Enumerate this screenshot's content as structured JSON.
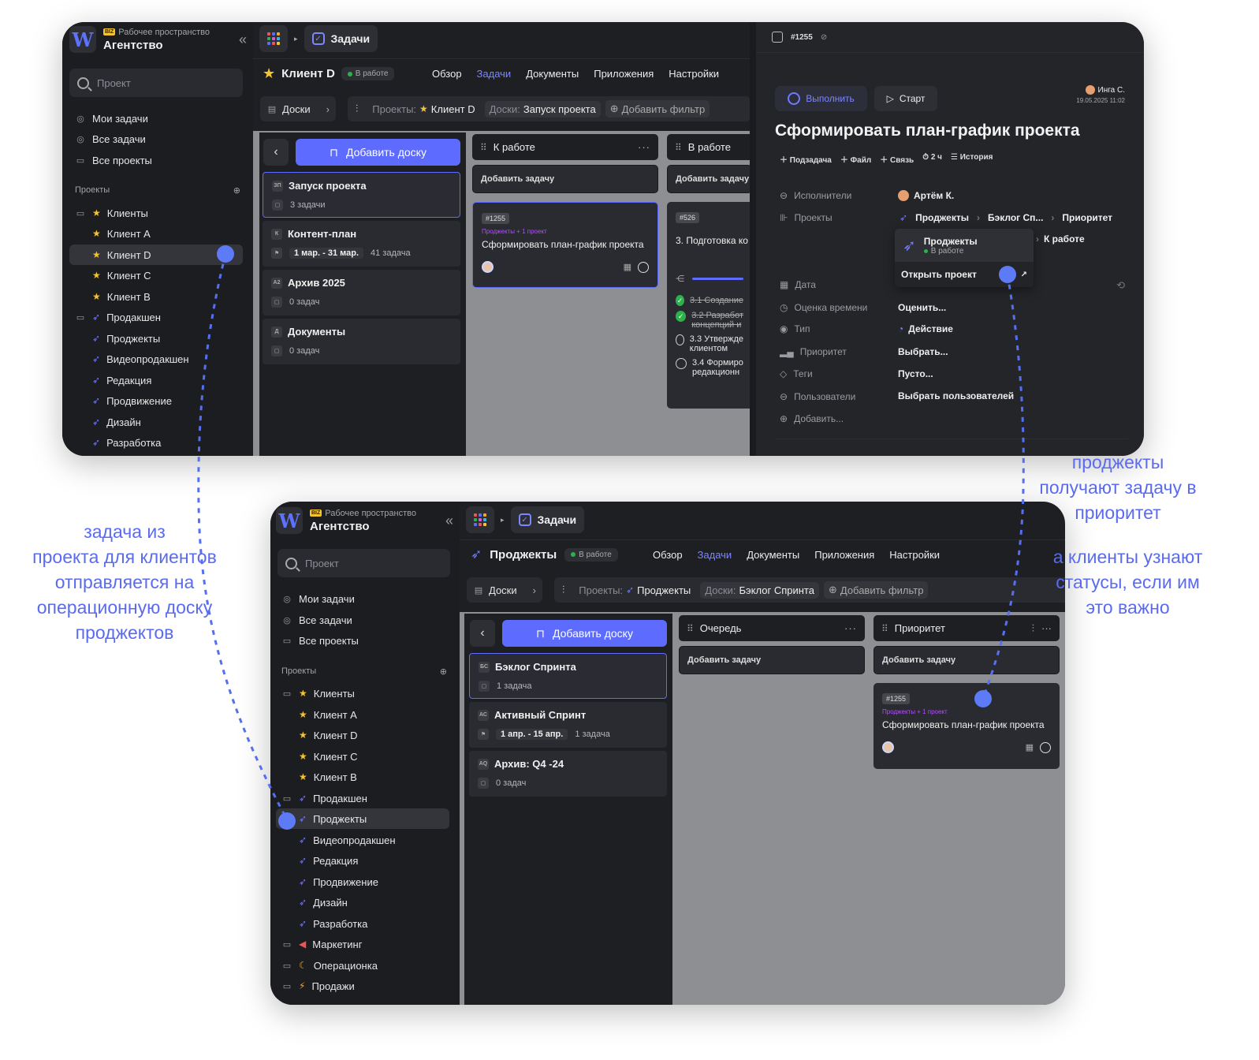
{
  "workspace": {
    "badge": "BIZ",
    "label": "Рабочее пространство",
    "name": "Агентство"
  },
  "search_placeholder": "Проект",
  "nav": [
    "Мои задачи",
    "Все задачи",
    "Все проекты"
  ],
  "projects_header": "Проекты",
  "sidebar_top": [
    "Клиенты",
    "Клиент А",
    "Клиент D",
    "Клиент С",
    "Клиент В",
    "Продакшен",
    "Проджекты",
    "Видеопродакшен",
    "Редакция",
    "Продвижение",
    "Дизайн",
    "Разработка"
  ],
  "sidebar_bottom": [
    "Клиенты",
    "Клиент А",
    "Клиент D",
    "Клиент С",
    "Клиент В",
    "Продакшен",
    "Проджекты",
    "Видеопродакшен",
    "Редакция",
    "Продвижение",
    "Дизайн",
    "Разработка",
    "Маркетинг",
    "Операционка",
    "Продажи"
  ],
  "top": {
    "app": "Задачи",
    "project": "Клиент D",
    "status": "В работе",
    "tabs": [
      "Обзор",
      "Задачи",
      "Документы",
      "Приложения",
      "Настройки"
    ],
    "filter_boards": "Доски",
    "filter_projects_label": "Проекты:",
    "filter_projects_value": "Клиент D",
    "filter_boards_label": "Доски:",
    "filter_boards_value": "Запуск проекта",
    "add_filter": "Добавить фильтр",
    "add_board": "Добавить доску",
    "boards": [
      {
        "abbr": "ЗП",
        "name": "Запуск проекта",
        "meta": "3 задачи"
      },
      {
        "abbr": "К",
        "name": "Контент-план",
        "dates": "1 мар. - 31 мар.",
        "meta": "41 задача"
      },
      {
        "abbr": "А2",
        "name": "Архив 2025",
        "meta": "0 задач"
      },
      {
        "abbr": "Д",
        "name": "Документы",
        "meta": "0 задач"
      }
    ],
    "col1": "К работе",
    "col2": "В работе",
    "add_task": "Добавить задачу",
    "task1": {
      "id": "#1255",
      "sub": "Проджекты + 1 проект",
      "title": "Сформировать план-график проекта"
    },
    "task2": {
      "id": "#526",
      "title": "3. Подготовка ко"
    },
    "subtasks": [
      {
        "text": "3.1 Создание",
        "done": true
      },
      {
        "text": "3.2 Разработ",
        "text2": "концепций и",
        "done": true
      },
      {
        "text": "3.3 Утвержде",
        "text2": "клиентом",
        "done": false
      },
      {
        "text": "3.4 Формиро",
        "text2": "редакционн",
        "done": false
      }
    ]
  },
  "panel": {
    "id": "#1255",
    "complete": "Выполнить",
    "start": "Старт",
    "author": "Инга С.",
    "date": "19.05.2025 11:02",
    "title": "Сформировать план-график проекта",
    "actions": [
      "Подзадача",
      "Файл",
      "Связь",
      "2 ч",
      "История"
    ],
    "fields": [
      {
        "label": "Исполнители",
        "value": "Артём К."
      },
      {
        "label": "Проекты",
        "value": "Проджекты"
      },
      {
        "label": "Дата",
        "value": ""
      },
      {
        "label": "Оценка времени",
        "value": "Оценить..."
      },
      {
        "label": "Тип",
        "value": "Действие"
      },
      {
        "label": "Приоритет",
        "value": "Выбрать..."
      },
      {
        "label": "Теги",
        "value": "Пусто..."
      },
      {
        "label": "Пользователи",
        "value": "Выбрать пользователей"
      },
      {
        "label": "Добавить...",
        "value": ""
      }
    ],
    "crumb1": "Бэклог Сп...",
    "crumb2": "Приоритет",
    "crumb3": "К работе",
    "popup_name": "Проджекты",
    "popup_status": "В работе",
    "popup_open": "Открыть проект"
  },
  "bottom": {
    "app": "Задачи",
    "project": "Проджекты",
    "status": "В работе",
    "tabs": [
      "Обзор",
      "Задачи",
      "Документы",
      "Приложения",
      "Настройки"
    ],
    "filter_boards": "Доски",
    "filter_projects_label": "Проекты:",
    "filter_projects_value": "Проджекты",
    "filter_boards_label": "Доски:",
    "filter_boards_value": "Бэклог Спринта",
    "add_filter": "Добавить фильтр",
    "add_board": "Добавить доску",
    "boards": [
      {
        "abbr": "БС",
        "name": "Бэклог Спринта",
        "meta": "1 задача"
      },
      {
        "abbr": "АС",
        "name": "Активный Спринт",
        "dates": "1 апр. - 15 апр.",
        "meta": "1 задача"
      },
      {
        "abbr": "АQ",
        "name": "Архив: Q4 -24",
        "meta": "0 задач"
      }
    ],
    "col1": "Очередь",
    "col2": "Приоритет",
    "add_task": "Добавить задачу",
    "task1": {
      "id": "#1255",
      "sub": "Проджекты + 1 проект",
      "title": "Сформировать план-график проекта"
    }
  },
  "notes": {
    "left": [
      "задача из",
      "проекта для клиентов",
      "отправляется на",
      "операционную доску",
      "проджектов"
    ],
    "right1": [
      "проджекты",
      "получают задачу в",
      "приоритет"
    ],
    "right2": [
      "а клиенты узнают",
      "статусы, если им",
      "это важно"
    ]
  },
  "colors": {
    "accent": "#5d6cff",
    "note": "#5a6bf0",
    "star": "#f5c430",
    "ok": "#2bb24c"
  }
}
